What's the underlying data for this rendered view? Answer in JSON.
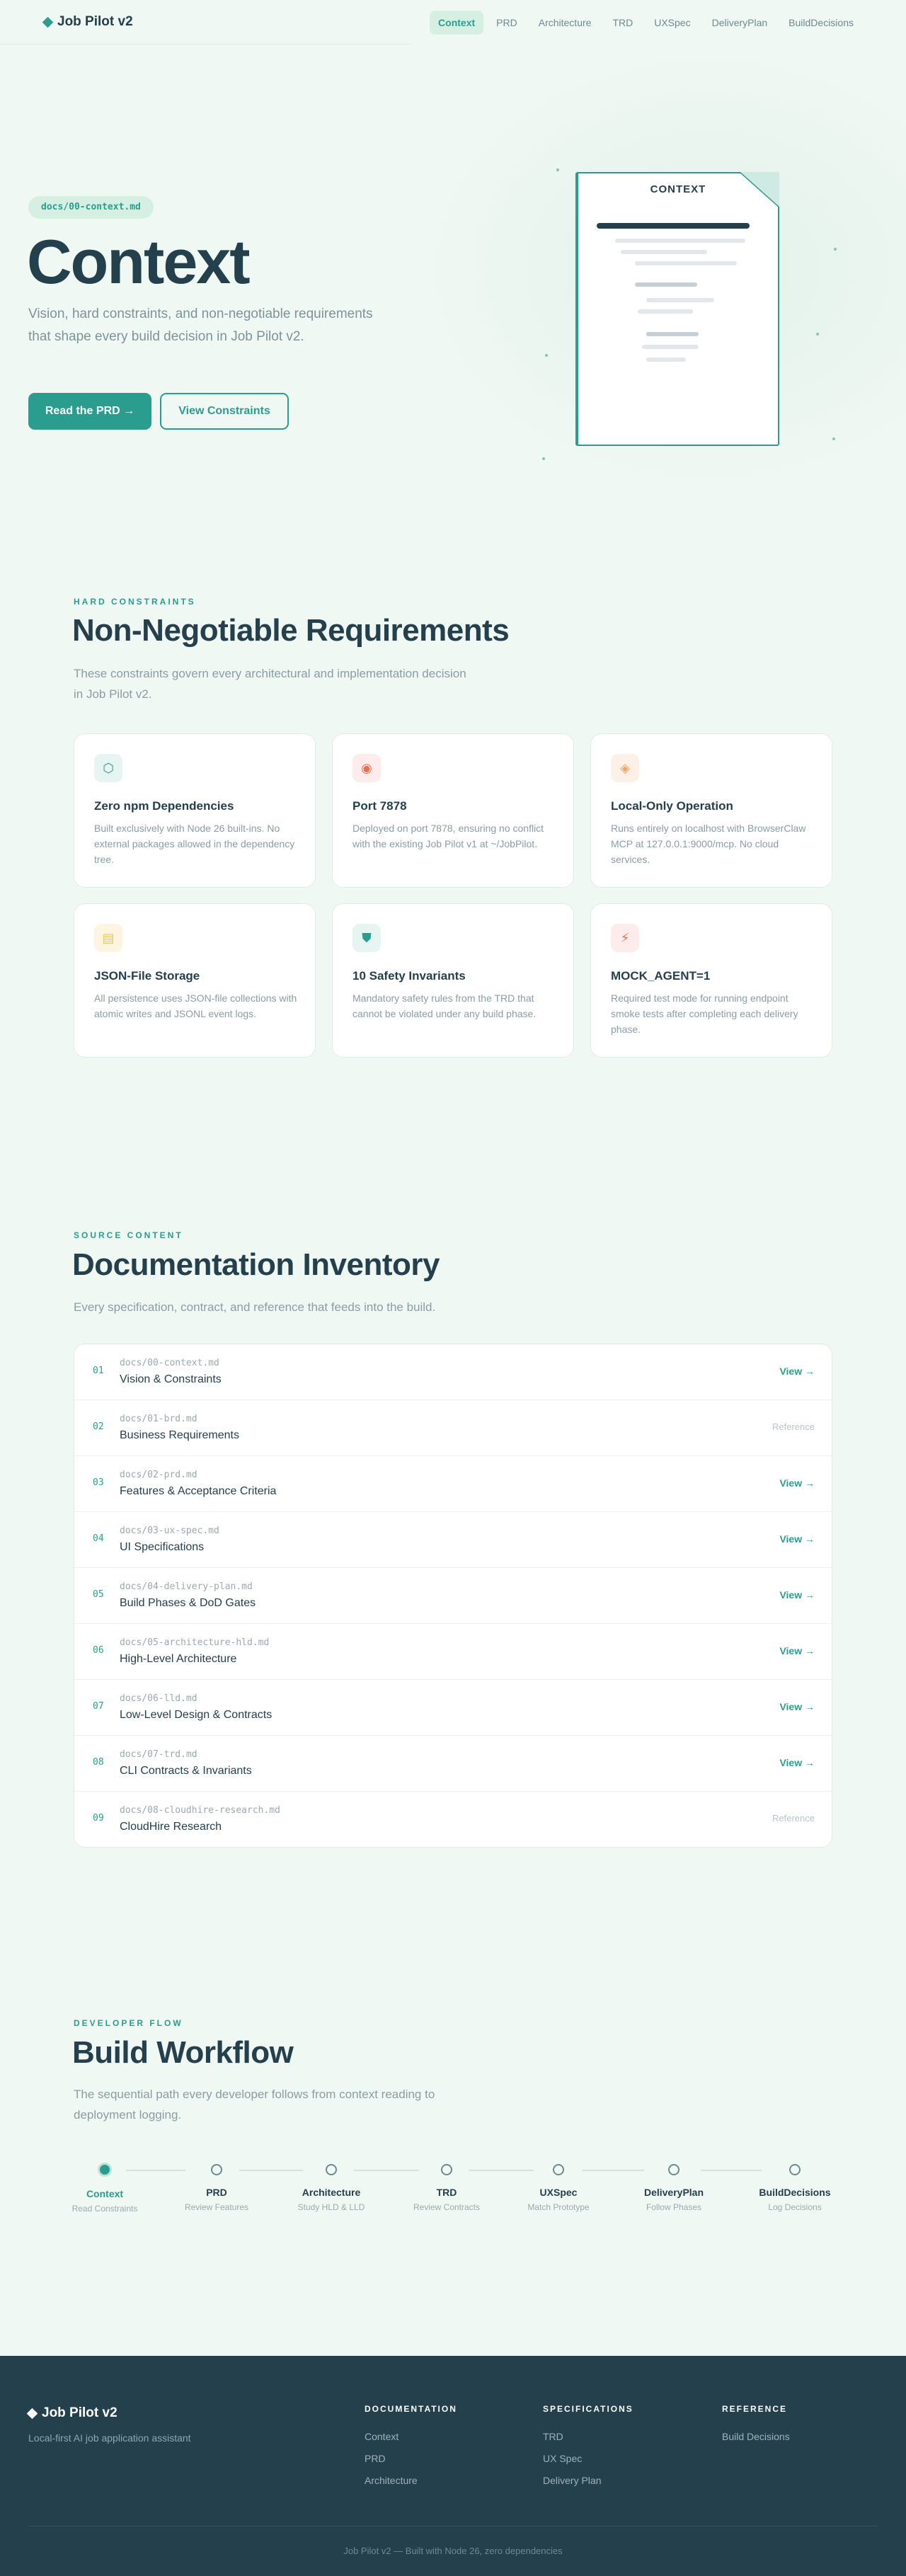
{
  "nav": {
    "brand": "Job Pilot v2",
    "links": [
      {
        "label": "Context",
        "active": true
      },
      {
        "label": "PRD"
      },
      {
        "label": "Architecture"
      },
      {
        "label": "TRD"
      },
      {
        "label": "UXSpec"
      },
      {
        "label": "DeliveryPlan"
      },
      {
        "label": "BuildDecisions"
      }
    ]
  },
  "hero": {
    "pill": "docs/00-context.md",
    "title": "Context",
    "subtitle": "Vision, hard constraints, and non-negotiable requirements that shape every build decision in Job Pilot v2.",
    "primary_button": "Read the PRD →",
    "secondary_button": "View Constraints",
    "doc_label": "CONTEXT"
  },
  "constraints": {
    "eyebrow": "HARD CONSTRAINTS",
    "title": "Non-Negotiable Requirements",
    "subtitle": "These constraints govern every architectural and implementation decision in Job Pilot v2.",
    "cards": [
      {
        "icon": "⬡",
        "icon_name": "hexagon-icon",
        "title": "Zero npm Dependencies",
        "desc": "Built exclusively with Node 26 built-ins. No external packages allowed in the dependency tree."
      },
      {
        "icon": "◉",
        "icon_name": "target-icon",
        "title": "Port 7878",
        "desc": "Deployed on port 7878, ensuring no conflict with the existing Job Pilot v1 at ~/JobPilot."
      },
      {
        "icon": "◈",
        "icon_name": "diamond-icon",
        "title": "Local-Only Operation",
        "desc": "Runs entirely on localhost with BrowserClaw MCP at 127.0.0.1:9000/mcp. No cloud services."
      },
      {
        "icon": "▤",
        "icon_name": "database-icon",
        "title": "JSON-File Storage",
        "desc": "All persistence uses JSON-file collections with atomic writes and JSONL event logs."
      },
      {
        "icon": "⛊",
        "icon_name": "shield-icon",
        "title": "10 Safety Invariants",
        "desc": "Mandatory safety rules from the TRD that cannot be violated under any build phase."
      },
      {
        "icon": "⚡",
        "icon_name": "lightning-icon",
        "title": "MOCK_AGENT=1",
        "desc": "Required test mode for running endpoint smoke tests after completing each delivery phase."
      }
    ]
  },
  "inventory": {
    "eyebrow": "SOURCE CONTENT",
    "title": "Documentation Inventory",
    "subtitle": "Every specification, contract, and reference that feeds into the build.",
    "rows": [
      {
        "num": "01",
        "file": "docs/00-context.md",
        "title": "Vision & Constraints",
        "action": "View →"
      },
      {
        "num": "02",
        "file": "docs/01-brd.md",
        "title": "Business Requirements",
        "action": "Reference"
      },
      {
        "num": "03",
        "file": "docs/02-prd.md",
        "title": "Features & Acceptance Criteria",
        "action": "View →"
      },
      {
        "num": "04",
        "file": "docs/03-ux-spec.md",
        "title": "UI Specifications",
        "action": "View →"
      },
      {
        "num": "05",
        "file": "docs/04-delivery-plan.md",
        "title": "Build Phases & DoD Gates",
        "action": "View →"
      },
      {
        "num": "06",
        "file": "docs/05-architecture-hld.md",
        "title": "High-Level Architecture",
        "action": "View →"
      },
      {
        "num": "07",
        "file": "docs/06-lld.md",
        "title": "Low-Level Design & Contracts",
        "action": "View →"
      },
      {
        "num": "08",
        "file": "docs/07-trd.md",
        "title": "CLI Contracts & Invariants",
        "action": "View →"
      },
      {
        "num": "09",
        "file": "docs/08-cloudhire-research.md",
        "title": "CloudHire Research",
        "action": "Reference"
      }
    ]
  },
  "workflow": {
    "eyebrow": "DEVELOPER FLOW",
    "title": "Build Workflow",
    "subtitle": "The sequential path every developer follows from context reading to deployment logging.",
    "steps": [
      {
        "name": "Context",
        "desc": "Read Constraints",
        "active": true
      },
      {
        "name": "PRD",
        "desc": "Review Features"
      },
      {
        "name": "Architecture",
        "desc": "Study HLD & LLD"
      },
      {
        "name": "TRD",
        "desc": "Review Contracts"
      },
      {
        "name": "UXSpec",
        "desc": "Match Prototype"
      },
      {
        "name": "DeliveryPlan",
        "desc": "Follow Phases"
      },
      {
        "name": "BuildDecisions",
        "desc": "Log Decisions"
      }
    ]
  },
  "footer": {
    "brand": "Job Pilot v2",
    "tagline": "Local-first AI job application assistant",
    "columns": [
      {
        "heading": "DOCUMENTATION",
        "links": [
          "Context",
          "PRD",
          "Architecture"
        ]
      },
      {
        "heading": "SPECIFICATIONS",
        "links": [
          "TRD",
          "UX Spec",
          "Delivery Plan"
        ]
      },
      {
        "heading": "REFERENCE",
        "links": [
          "Build Decisions"
        ]
      }
    ],
    "copyright": "Job Pilot v2 — Built with Node 26, zero dependencies"
  },
  "colors": {
    "accent": "#2a9d8f",
    "dark": "#24404d",
    "background": "#f0f8f3"
  }
}
